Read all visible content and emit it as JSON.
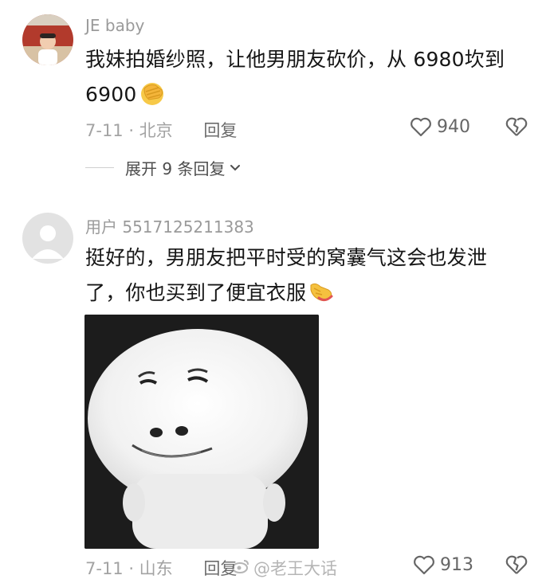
{
  "comments": [
    {
      "username": "JE  baby",
      "text": "我妹拍婚纱照，让他男朋友砍价，从 6980坎到6900",
      "emoji": "face-palm-emoji",
      "date_location": "7-11 · 北京",
      "reply_label": "回复",
      "like_count": "940",
      "expand_label": "展开 9 条回复"
    },
    {
      "username": "用户 5517125211383",
      "text": "挺好的，男朋友把平时受的窝囊气这会也发泄了，你也买到了便宜衣服",
      "emoji": "pointing-hand-emoji",
      "date_location": "7-11 · 山东",
      "reply_label": "回复",
      "like_count": "913"
    }
  ],
  "watermark": "@老王大话",
  "colors": {
    "meta_gray": "#a3a3a3",
    "text_dark": "#161616",
    "reply_gray": "#6c6c6c"
  }
}
